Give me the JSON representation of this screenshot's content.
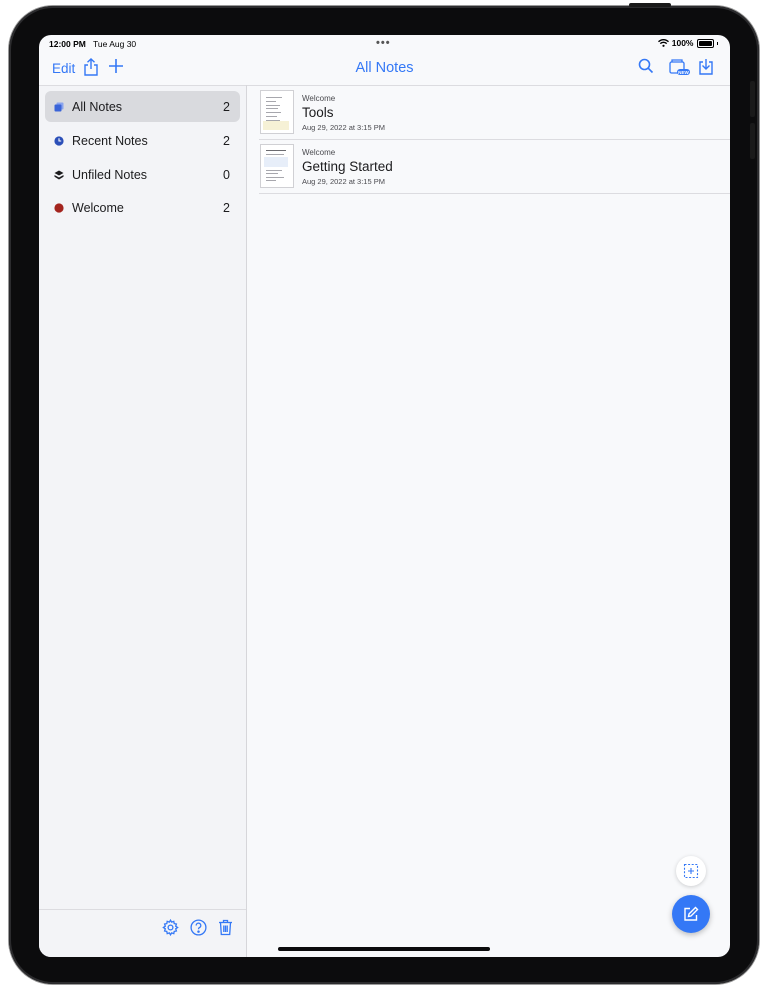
{
  "status_bar": {
    "time": "12:00 PM",
    "date": "Tue Aug 30",
    "dots": "•••",
    "battery_text": "100%"
  },
  "toolbar": {
    "edit_label": "Edit",
    "title": "All Notes",
    "new_badge": "NEW"
  },
  "sidebar": {
    "items": [
      {
        "label": "All Notes",
        "count": "2",
        "icon": "all-notes-icon",
        "color": "#3a64d8",
        "active": true
      },
      {
        "label": "Recent Notes",
        "count": "2",
        "icon": "clock-icon",
        "color": "#2b4fb8",
        "active": false
      },
      {
        "label": "Unfiled Notes",
        "count": "0",
        "icon": "stack-icon",
        "color": "#1c1c1e",
        "active": false
      },
      {
        "label": "Welcome",
        "count": "2",
        "icon": "folder-dot-icon",
        "color": "#a3241e",
        "active": false
      }
    ],
    "footer_icons": [
      "gear-icon",
      "help-icon",
      "trash-icon"
    ]
  },
  "notes": [
    {
      "folder": "Welcome",
      "title": "Tools",
      "date": "Aug 29, 2022 at 3:15 PM"
    },
    {
      "folder": "Welcome",
      "title": "Getting Started",
      "date": "Aug 29, 2022 at 3:15 PM"
    }
  ],
  "colors": {
    "accent": "#3478f6",
    "sidebar_bg": "#f3f4f7",
    "content_bg": "#f8f9fb",
    "active_row": "#d9dade"
  }
}
